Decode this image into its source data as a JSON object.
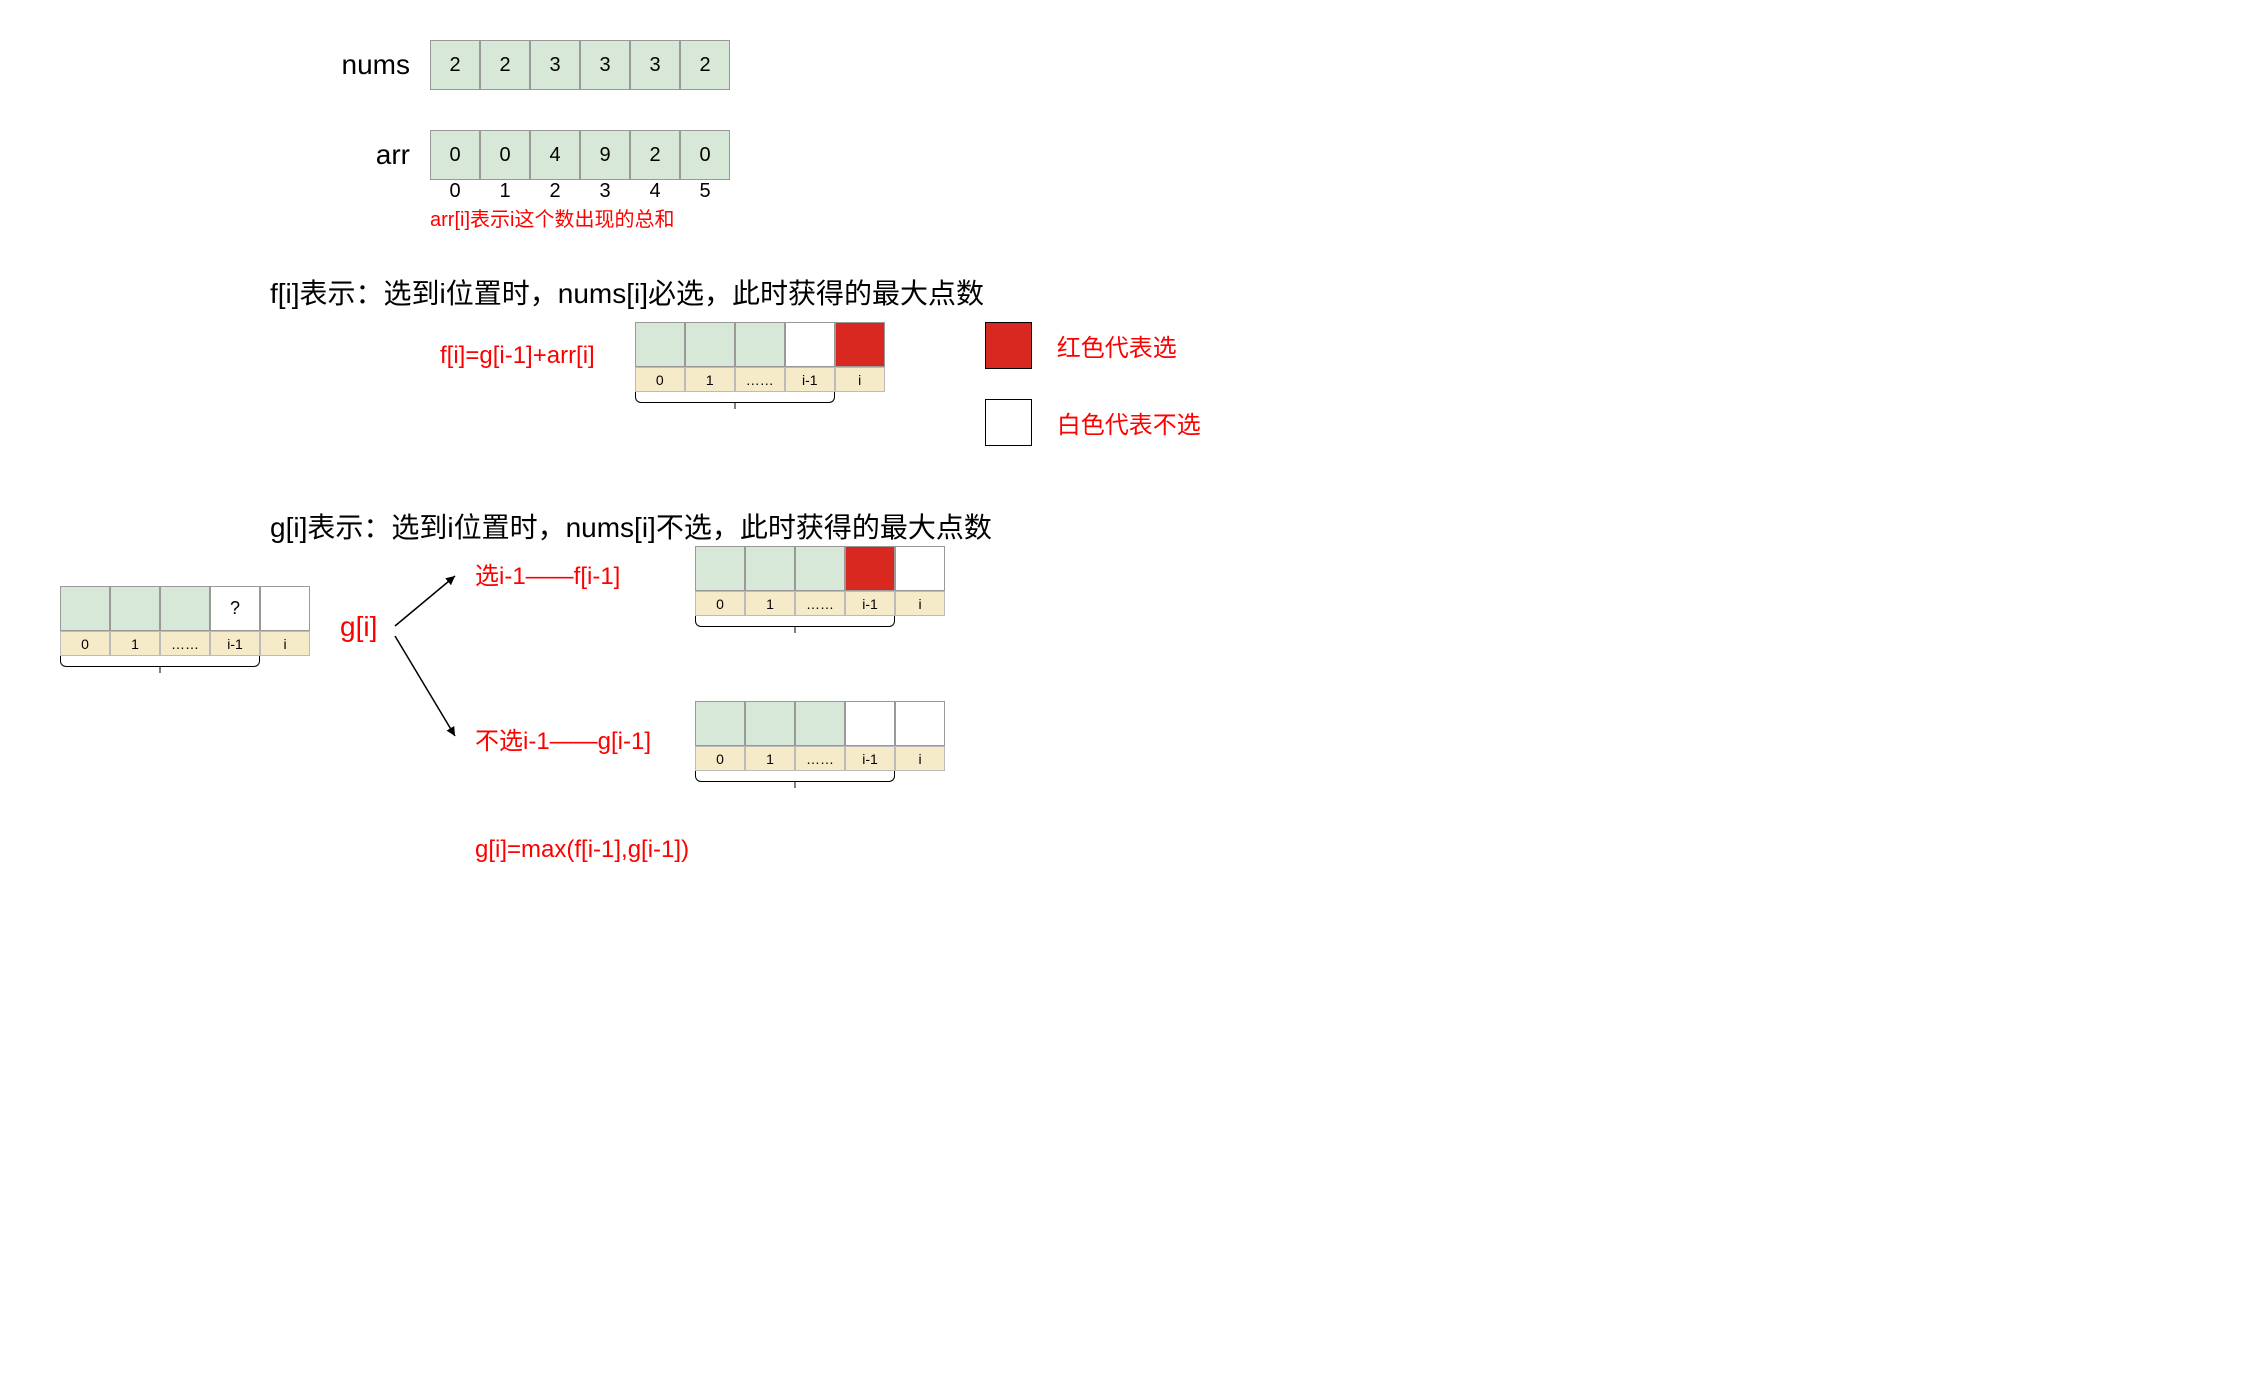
{
  "nums_label": "nums",
  "nums_values": [
    "2",
    "2",
    "3",
    "3",
    "3",
    "2"
  ],
  "arr_label": "arr",
  "arr_values": [
    "0",
    "0",
    "4",
    "9",
    "2",
    "0"
  ],
  "arr_indices": [
    "0",
    "1",
    "2",
    "3",
    "4",
    "5"
  ],
  "arr_note": "arr[i]表示i这个数出现的总和",
  "f_desc": "f[i]表示：选到i位置时，nums[i]必选，此时获得的最大点数",
  "f_formula": "f[i]=g[i-1]+arr[i]",
  "g_desc": "g[i]表示：选到i位置时，nums[i]不选，此时获得的最大点数",
  "g_label": "g[i]",
  "g_branch1": "选i-1——f[i-1]",
  "g_branch2": "不选i-1——g[i-1]",
  "g_formula": "g[i]=max(f[i-1],g[i-1])",
  "legend_red": "红色代表选",
  "legend_white": "白色代表不选",
  "cell_labels": {
    "l0": "0",
    "l1": "1",
    "ldots": "……",
    "li_1": "i-1",
    "li": "i",
    "q": "?"
  }
}
